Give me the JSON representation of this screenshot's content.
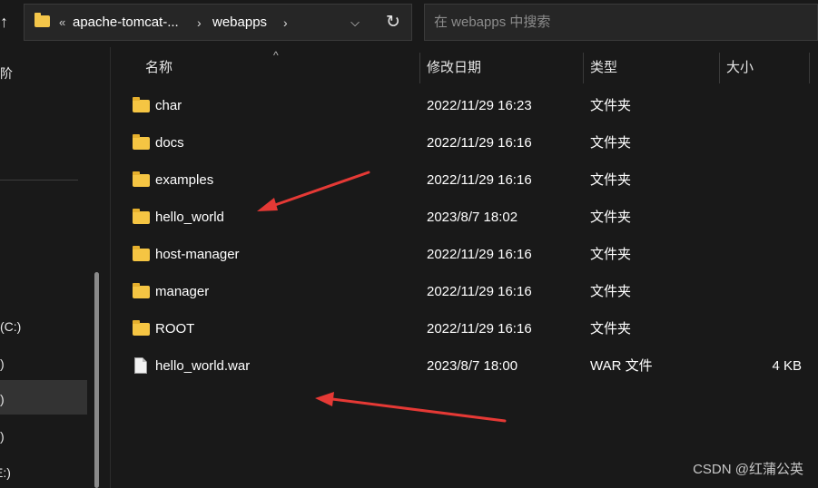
{
  "address_bar": {
    "overflow_glyph": "«",
    "segments": [
      "apache-tomcat-...",
      "webapps"
    ],
    "chevron_glyph": "›",
    "dropdown_glyph": "⌵",
    "refresh_glyph": "↻"
  },
  "search": {
    "placeholder": "在 webapps 中搜索"
  },
  "nav_pane": {
    "items": [
      "阶",
      "(C:)",
      ")",
      ")",
      ")",
      "E:)"
    ]
  },
  "columns": {
    "name": "名称",
    "date": "修改日期",
    "type": "类型",
    "size": "大小",
    "sort_caret": "^"
  },
  "files": [
    {
      "name": "char",
      "date": "2022/11/29 16:23",
      "type": "文件夹",
      "size": "",
      "icon": "folder-icon"
    },
    {
      "name": "docs",
      "date": "2022/11/29 16:16",
      "type": "文件夹",
      "size": "",
      "icon": "folder-icon"
    },
    {
      "name": "examples",
      "date": "2022/11/29 16:16",
      "type": "文件夹",
      "size": "",
      "icon": "folder-icon"
    },
    {
      "name": "hello_world",
      "date": "2023/8/7 18:02",
      "type": "文件夹",
      "size": "",
      "icon": "folder-icon"
    },
    {
      "name": "host-manager",
      "date": "2022/11/29 16:16",
      "type": "文件夹",
      "size": "",
      "icon": "folder-icon"
    },
    {
      "name": "manager",
      "date": "2022/11/29 16:16",
      "type": "文件夹",
      "size": "",
      "icon": "folder-icon"
    },
    {
      "name": "ROOT",
      "date": "2022/11/29 16:16",
      "type": "文件夹",
      "size": "",
      "icon": "folder-icon"
    },
    {
      "name": "hello_world.war",
      "date": "2023/8/7 18:00",
      "type": "WAR 文件",
      "size": "4 KB",
      "icon": "file-icon"
    }
  ],
  "watermark": "CSDN @红蒲公英",
  "colors": {
    "background": "#191919",
    "folder": "#f5c543",
    "annotation_arrow": "#e53935"
  }
}
